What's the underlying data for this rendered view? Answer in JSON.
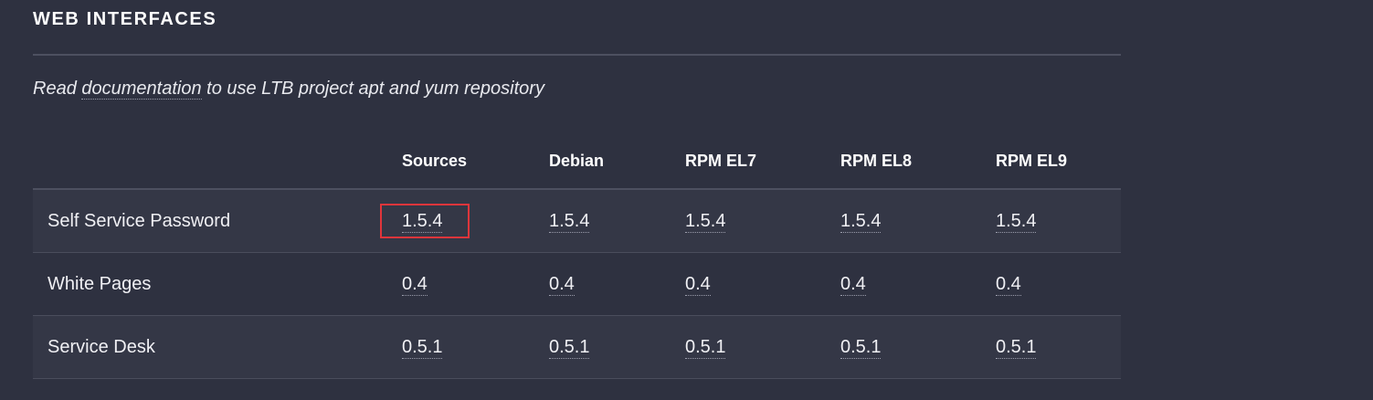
{
  "section": {
    "title": "WEB INTERFACES",
    "intro_prefix": "Read ",
    "intro_link": "documentation",
    "intro_suffix": " to use LTB project apt and yum repository"
  },
  "table": {
    "headers": [
      "",
      "Sources",
      "Debian",
      "RPM EL7",
      "RPM EL8",
      "RPM EL9"
    ],
    "rows": [
      {
        "name": "Self Service Password",
        "versions": [
          "1.5.4",
          "1.5.4",
          "1.5.4",
          "1.5.4",
          "1.5.4"
        ]
      },
      {
        "name": "White Pages",
        "versions": [
          "0.4",
          "0.4",
          "0.4",
          "0.4",
          "0.4"
        ]
      },
      {
        "name": "Service Desk",
        "versions": [
          "0.5.1",
          "0.5.1",
          "0.5.1",
          "0.5.1",
          "0.5.1"
        ]
      }
    ]
  },
  "highlight": {
    "row": 0,
    "column": 1,
    "color": "#e0353b"
  }
}
